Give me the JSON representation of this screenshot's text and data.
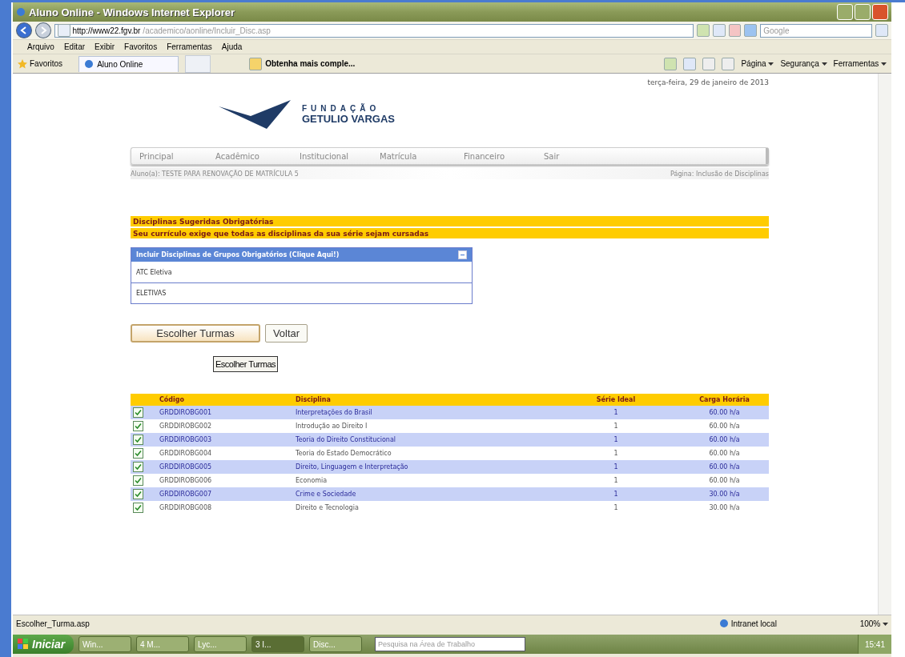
{
  "window": {
    "title": "Aluno Online - Windows Internet Explorer"
  },
  "address_bar": {
    "url_host": "http://www22.fgv.br",
    "url_path": "/academico/aonline/Incluir_Disc.asp"
  },
  "search": {
    "placeholder": "Google"
  },
  "menu": [
    "Arquivo",
    "Editar",
    "Exibir",
    "Favoritos",
    "Ferramentas",
    "Ajuda"
  ],
  "favorites_bar": {
    "favorites": "Favoritos",
    "tabs": [
      {
        "label": "Aluno Online",
        "selected": true
      }
    ],
    "link": "Obtenha mais comple...",
    "commands": [
      "Página",
      "Segurança",
      "Ferramentas"
    ]
  },
  "page": {
    "date": "terça-feira, 29 de janeiro de 2013",
    "logo": {
      "line1": "FUNDAÇÃO",
      "line2": "GETULIO VARGAS"
    },
    "nav": [
      "Principal",
      "Acadêmico",
      "Institucional",
      "Matrícula",
      "Financeiro",
      "Sair"
    ],
    "student": "Aluno(a): TESTE PARA RENOVAÇÃO DE MATRÍCULA 5",
    "page_name": "Página: Inclusão de Disciplinas",
    "notices": [
      "Disciplinas Sugeridas Obrigatórias",
      "Seu currículo exige que todas as disciplinas da sua série sejam cursadas"
    ],
    "group_panel": {
      "title": "Incluir Disciplinas de Grupos Obrigatórios (Clique Aqui!)",
      "expanded": true,
      "items": [
        "ATC Eletiva",
        "ELETIVAS"
      ]
    },
    "buttons": [
      {
        "label": "Escolher Turmas",
        "kind": "primary"
      },
      {
        "label": "Voltar",
        "kind": "plain"
      }
    ],
    "small_button": "Escolher Turmas",
    "table": {
      "columns": [
        "Código",
        "Disciplina",
        "Série Ideal",
        "Carga Horária"
      ],
      "rows": [
        {
          "checked": true,
          "cells": [
            "GRDDIROBG001",
            "Interpretações do Brasil",
            "1",
            "60.00 h/a"
          ]
        },
        {
          "checked": true,
          "cells": [
            "GRDDIROBG002",
            "Introdução ao Direito I",
            "1",
            "60.00 h/a"
          ]
        },
        {
          "checked": true,
          "cells": [
            "GRDDIROBG003",
            "Teoria do Direito Constitucional",
            "1",
            "60.00 h/a"
          ]
        },
        {
          "checked": true,
          "cells": [
            "GRDDIROBG004",
            "Teoria do Estado Democrático",
            "1",
            "60.00 h/a"
          ]
        },
        {
          "checked": true,
          "cells": [
            "GRDDIROBG005",
            "Direito, Linguagem e Interpretação",
            "1",
            "60.00 h/a"
          ]
        },
        {
          "checked": true,
          "cells": [
            "GRDDIROBG006",
            "Economia",
            "1",
            "60.00 h/a"
          ]
        },
        {
          "checked": true,
          "cells": [
            "GRDDIROBG007",
            "Crime e Sociedade",
            "1",
            "30.00 h/a"
          ]
        },
        {
          "checked": true,
          "cells": [
            "GRDDIROBG008",
            "Direito e Tecnologia",
            "1",
            "30.00 h/a"
          ]
        }
      ]
    }
  },
  "status_bar": {
    "text": "Escolher_Turma.asp",
    "zone": "Intranet local",
    "zoom": "100%"
  },
  "taskbar": {
    "start": "Iniciar",
    "items": [
      {
        "label": "Win...",
        "selected": false
      },
      {
        "label": "4 M...",
        "selected": false
      },
      {
        "label": "Lyc...",
        "selected": false
      },
      {
        "label": "3 I...",
        "selected": true
      },
      {
        "label": "Disc...",
        "selected": false
      }
    ],
    "search": {
      "placeholder": "Pesquisa na Área de Trabalho"
    },
    "clock": "15:41"
  }
}
